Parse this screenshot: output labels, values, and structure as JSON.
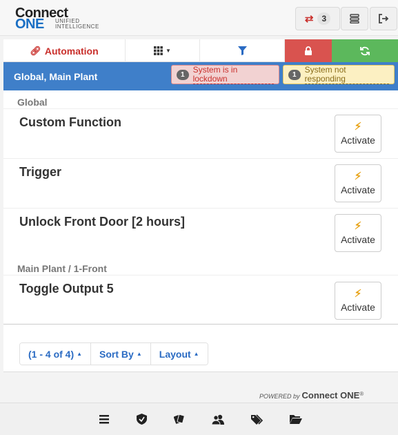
{
  "header": {
    "logo": {
      "line1": "Connect",
      "line2": "ONE",
      "tagline1": "UNIFIED",
      "tagline2": "INTELLIGENCE"
    },
    "sync_count": "3"
  },
  "nav": {
    "automation_label": "Automation"
  },
  "bluebar": {
    "title": "Global, Main Plant",
    "alerts": [
      {
        "count": "1",
        "text": "System is in lockdown",
        "color": "#c9302c"
      },
      {
        "count": "1",
        "text": "System not responding",
        "color": "#8a6d1a"
      }
    ]
  },
  "groups": [
    {
      "label": "Global"
    },
    {
      "label": "Main Plant / 1-Front"
    }
  ],
  "items": [
    {
      "name": "Custom Function",
      "action": "Activate"
    },
    {
      "name": "Trigger",
      "action": "Activate"
    },
    {
      "name": "Unlock Front Door [2 hours]",
      "action": "Activate"
    },
    {
      "name": "Toggle Output 5",
      "action": "Activate"
    }
  ],
  "toolbar": {
    "range_label": "(1 - 4 of 4)",
    "sort_label": "Sort By",
    "layout_label": "Layout"
  },
  "footer": {
    "powered_by": "POWERED by",
    "brand": "Connect ONE",
    "registered": "®"
  },
  "bottom_icons": [
    "menu-icon",
    "shield-icon",
    "badges-icon",
    "users-icon",
    "tags-icon",
    "folder-icon"
  ],
  "colors": {
    "accent_blue": "#3f7fc9",
    "danger": "#d9534f",
    "success": "#5cb85c",
    "bolt": "#e8a317"
  }
}
